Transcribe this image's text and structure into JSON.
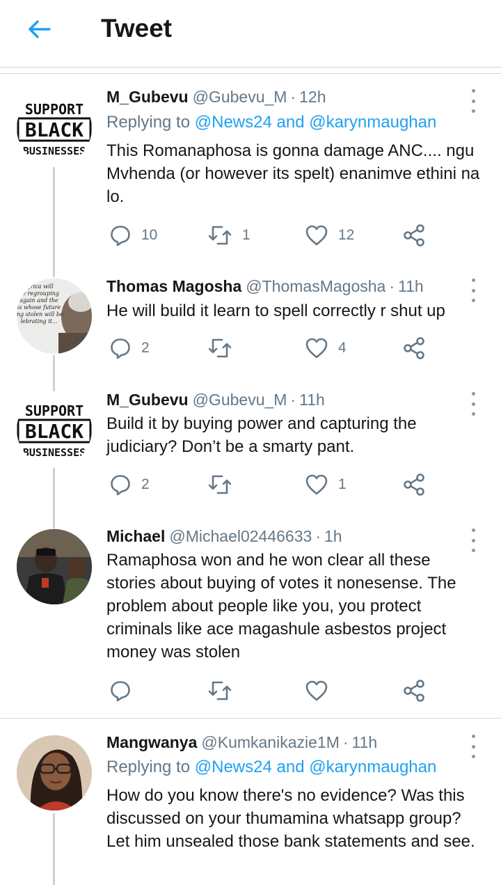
{
  "header": {
    "title": "Tweet"
  },
  "colors": {
    "accent": "#1da1f2",
    "secondary_text": "#657786",
    "icon_gray": "#657786"
  },
  "tweets": [
    {
      "name": "M_Gubevu",
      "handle": "@Gubevu_M",
      "dot": "·",
      "time": "12h",
      "replying_prefix": "Replying to",
      "replying_user1": "@News24",
      "replying_and": "and",
      "replying_user2": "@karynmaughan",
      "body": "This Romanaphosa is gonna damage ANC.... ngu Mvhenda (or however its spelt) enanimve ethini na lo.",
      "reply_count": "10",
      "retweet_count": "1",
      "like_count": "12",
      "avatar_text": [
        "SUPPORT",
        "BLACK",
        "BUSINESSES"
      ]
    },
    {
      "name": "Thomas Magosha",
      "handle": "@ThomasMagosha",
      "dot": "·",
      "time": "11h",
      "body": "He will build it learn to spell correctly r shut up",
      "reply_count": "2",
      "retweet_count": "",
      "like_count": "4",
      "avatar_text": [
        "Africa will",
        "be regrouping",
        "again and the",
        "is whose future",
        "ing stolen will be",
        "lebrating it..."
      ]
    },
    {
      "name": "M_Gubevu",
      "handle": "@Gubevu_M",
      "dot": "·",
      "time": "11h",
      "body": "Build it by buying power and capturing the judiciary? Don’t be a smarty pant.",
      "reply_count": "2",
      "retweet_count": "",
      "like_count": "1",
      "avatar_text": [
        "SUPPORT",
        "BLACK",
        "BUSINESSES"
      ]
    },
    {
      "name": "Michael",
      "handle": "@Michael02446633",
      "dot": "·",
      "time": "1h",
      "body": "Ramaphosa won and he won clear all these stories about buying of votes it nonesense. The problem about people like you, you protect criminals like ace magashule asbestos project money was stolen",
      "reply_count": "",
      "retweet_count": "",
      "like_count": ""
    },
    {
      "name": "Mangwanya",
      "handle": "@Kumkanikazie1M",
      "dot": "·",
      "time": "11h",
      "replying_prefix": "Replying to",
      "replying_user1": "@News24",
      "replying_and": "and",
      "replying_user2": "@karynmaughan",
      "body": "How do you know there's no evidence? Was this discussed on your thumamina whatsapp group? Let him unsealed those bank statements and see."
    }
  ]
}
